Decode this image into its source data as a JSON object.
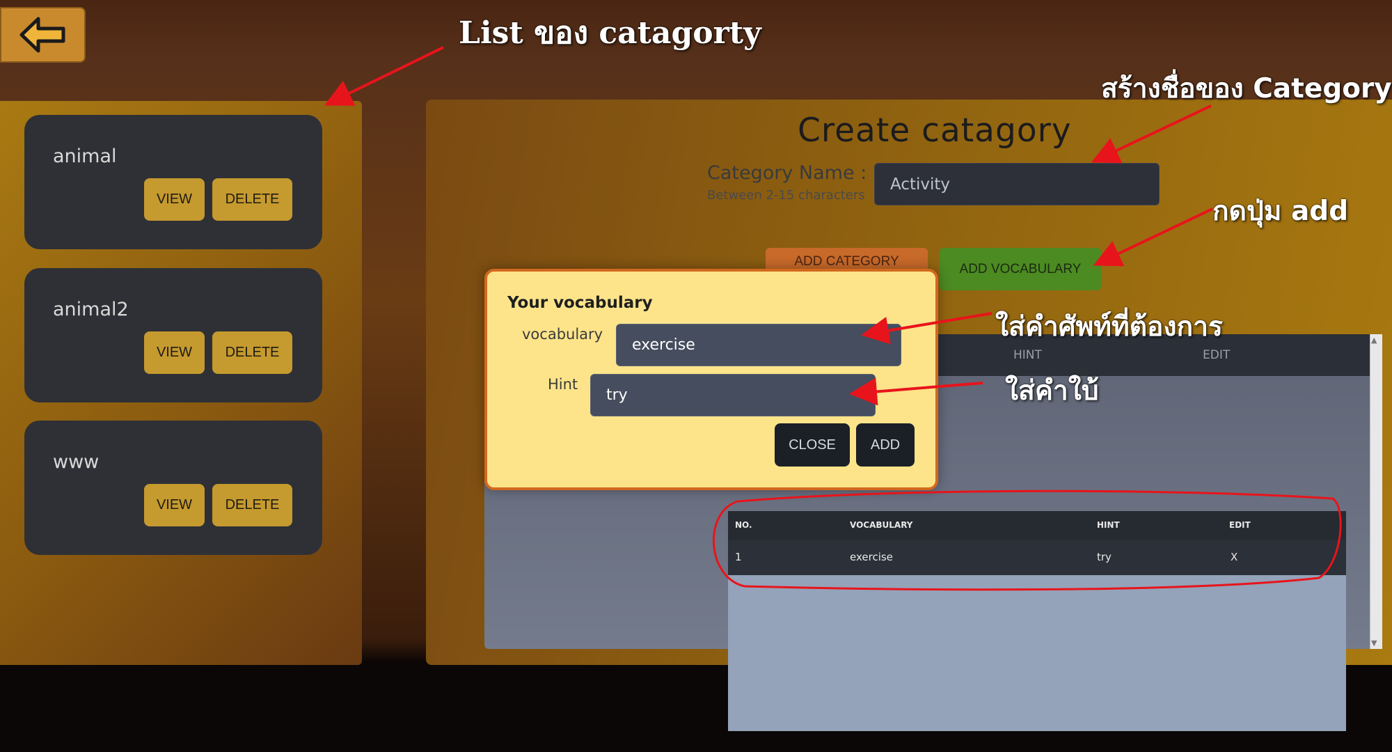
{
  "back_button": {
    "icon": "arrow-left-icon"
  },
  "categories": [
    {
      "name": "animal",
      "view_label": "VIEW",
      "delete_label": "DELETE"
    },
    {
      "name": "animal2",
      "view_label": "VIEW",
      "delete_label": "DELETE"
    },
    {
      "name": "www",
      "view_label": "VIEW",
      "delete_label": "DELETE"
    }
  ],
  "create": {
    "title": "Create catagory",
    "category_name_label": "Category Name :",
    "category_name_hint": "Between 2-15 characters",
    "category_name_value": "Activity",
    "add_category_label": "ADD CATEGORY",
    "add_vocabulary_label": "ADD VOCABULARY"
  },
  "background_table": {
    "headers": [
      "HINT",
      "EDIT"
    ]
  },
  "modal": {
    "title": "Your vocabulary",
    "vocabulary_label": "vocabulary",
    "vocabulary_value": "exercise",
    "hint_label": "Hint",
    "hint_value": "try",
    "close_label": "CLOSE",
    "add_label": "ADD"
  },
  "result_table": {
    "headers": [
      "NO.",
      "VOCABULARY",
      "HINT",
      "EDIT"
    ],
    "rows": [
      [
        "1",
        "exercise",
        "try",
        "X"
      ]
    ]
  },
  "annotations": {
    "list_category": "List ของ catagorty",
    "create_name": "สร้างชื่อของ Category",
    "press_add": "กดปุ่ม add",
    "enter_vocab": "ใส่คำศัพท์ที่ต้องการ",
    "enter_hint": "ใส่คำใบ้"
  },
  "colors": {
    "annotation_arrow": "#e8141b",
    "add_vocab_button": "#4c8a22",
    "modal_bg": "#fde48a"
  }
}
